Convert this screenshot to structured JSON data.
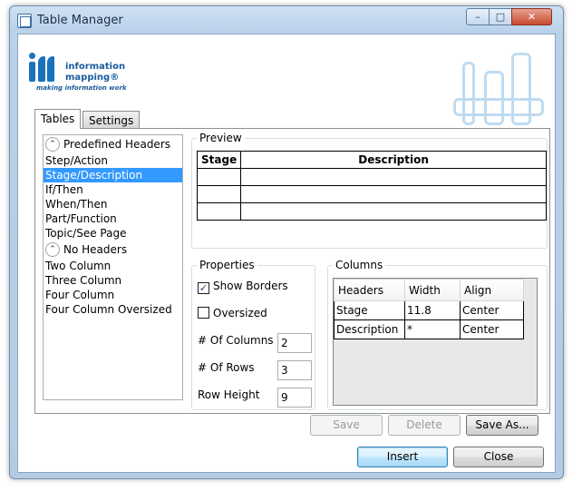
{
  "window": {
    "title": "Table Manager",
    "minimize_glyph": "–",
    "maximize_glyph": "□",
    "close_glyph": "✕"
  },
  "logo": {
    "line1": "information",
    "line2": "mapping®",
    "tagline": "making information work"
  },
  "tabs": [
    {
      "label": "Tables",
      "active": true
    },
    {
      "label": "Settings",
      "active": false
    }
  ],
  "list": {
    "groups": [
      {
        "header": "Predefined Headers",
        "items": [
          "Step/Action",
          "Stage/Description",
          "If/Then",
          "When/Then",
          "Part/Function",
          "Topic/See Page"
        ]
      },
      {
        "header": "No Headers",
        "items": [
          "Two Column",
          "Three Column",
          "Four Column",
          "Four Column Oversized"
        ]
      }
    ],
    "selected": "Stage/Description",
    "collapse_glyph": "⌃"
  },
  "preview": {
    "title": "Preview",
    "headers": [
      "Stage",
      "Description"
    ],
    "empty_rows": 3
  },
  "properties": {
    "title": "Properties",
    "show_borders_label": "Show Borders",
    "show_borders_checked": true,
    "oversized_label": "Oversized",
    "oversized_checked": false,
    "check_glyph": "✓",
    "columns_label": "# Of Columns",
    "columns_value": "2",
    "rows_label": "# Of Rows",
    "rows_value": "3",
    "row_height_label": "Row Height",
    "row_height_value": "9"
  },
  "columns": {
    "title": "Columns",
    "headers": [
      "Headers",
      "Width",
      "Align"
    ],
    "rows": [
      {
        "header": "Stage",
        "width": "11.8",
        "align": "Center"
      },
      {
        "header": "Description",
        "width": "*",
        "align": "Center"
      }
    ]
  },
  "actions": {
    "save": "Save",
    "delete": "Delete",
    "save_as": "Save As...",
    "insert": "Insert",
    "close": "Close"
  }
}
